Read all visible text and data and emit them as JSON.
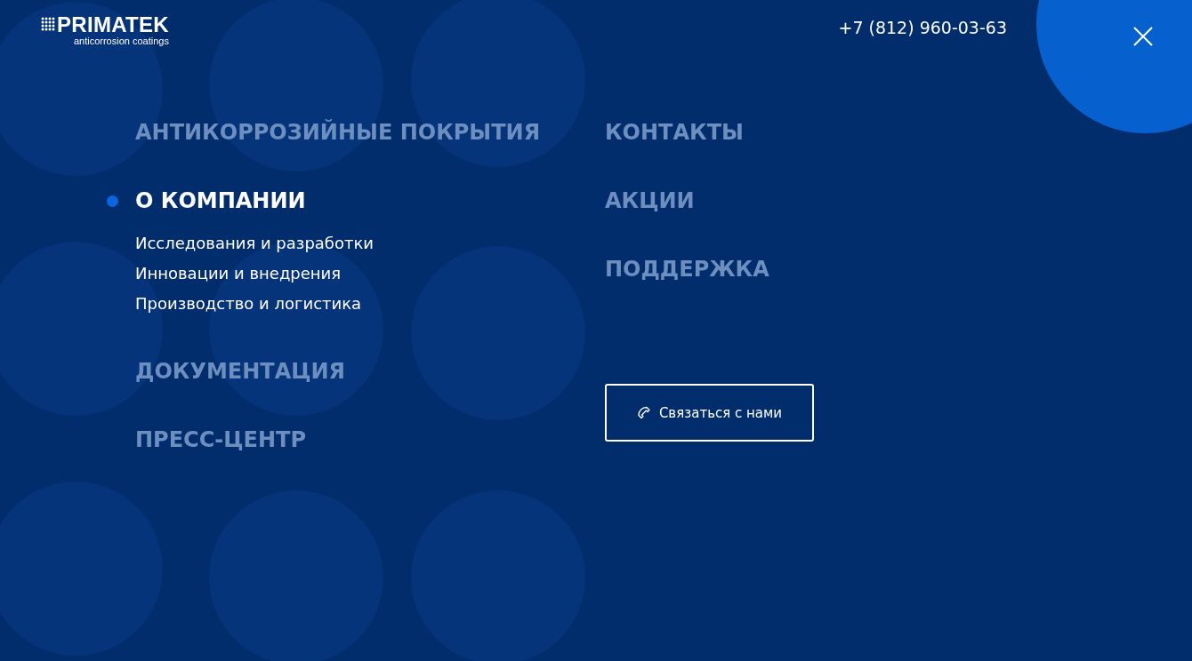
{
  "logo": {
    "name": "PRIMATEK",
    "tagline": "anticorrosion coatings"
  },
  "phone": "+7 (812) 960-03-63",
  "menu_left": [
    {
      "label": "АНТИКОРРОЗИЙНЫЕ ПОКРЫТИЯ",
      "selected": false
    },
    {
      "label": "О КОМПАНИИ",
      "selected": true,
      "children": [
        {
          "label": "Исследования и разработки"
        },
        {
          "label": "Инновации и внедрения"
        },
        {
          "label": "Производство и логистика"
        }
      ]
    },
    {
      "label": "ДОКУМЕНТАЦИЯ",
      "selected": false
    },
    {
      "label": "ПРЕСС-ЦЕНТР",
      "selected": false
    }
  ],
  "menu_right": [
    {
      "label": "КОНТАКТЫ",
      "selected": false
    },
    {
      "label": "АКЦИИ",
      "selected": false
    },
    {
      "label": "ПОДДЕРЖКА",
      "selected": false
    }
  ],
  "contact_button": "Связаться с нами"
}
